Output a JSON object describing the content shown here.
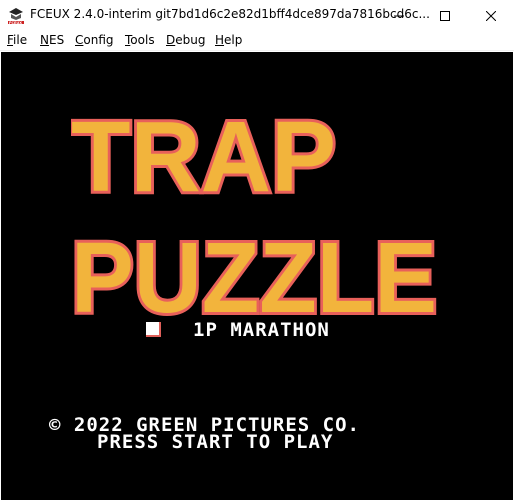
{
  "window": {
    "title": "FCEUX 2.4.0-interim git7bd1d6c2e82d1bff4dce897da7816bcd6c...",
    "icon": "fceux-app-icon",
    "controls": [
      "minimize-icon",
      "maximize-icon",
      "close-icon"
    ]
  },
  "menu": [
    {
      "label": "File",
      "accel": "F",
      "rest": "ile"
    },
    {
      "label": "NES",
      "accel": "N",
      "rest": "ES"
    },
    {
      "label": "Config",
      "accel": "C",
      "rest": "onfig"
    },
    {
      "label": "Tools",
      "accel": "T",
      "rest": "ools"
    },
    {
      "label": "Debug",
      "accel": "D",
      "rest": "ebug"
    },
    {
      "label": "Help",
      "accel": "H",
      "rest": "elp"
    }
  ],
  "game": {
    "logo_line1": "TRAP",
    "logo_line2": "PUZZLE",
    "logo_fill": "#f2b43c",
    "logo_outline": "#e8605a",
    "menu_option": "1P MARATHON",
    "copyright": "© 2022 GREEN PICTURES CO.",
    "prompt": "PRESS START TO PLAY",
    "background": "#000000",
    "text_color": "#ffffff"
  }
}
